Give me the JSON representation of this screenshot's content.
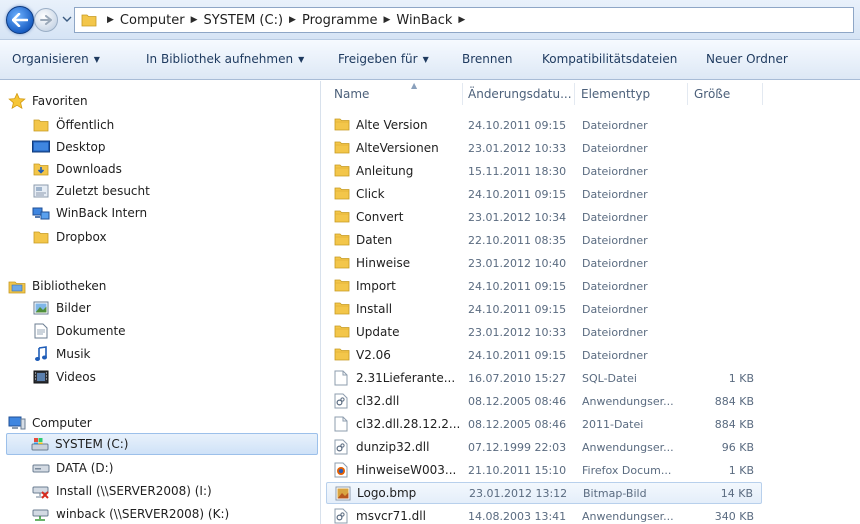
{
  "address": {
    "crumbs": [
      "Computer",
      "SYSTEM (C:)",
      "Programme",
      "WinBack"
    ]
  },
  "toolbar": {
    "organize": "Organisieren",
    "library": "In Bibliothek aufnehmen",
    "share": "Freigeben für",
    "burn": "Brennen",
    "compat": "Kompatibilitätsdateien",
    "new_folder": "Neuer Ordner"
  },
  "nav": {
    "favorites": {
      "label": "Favoriten",
      "items": [
        "Öffentlich",
        "Desktop",
        "Downloads",
        "Zuletzt besucht",
        "WinBack Intern",
        "Dropbox"
      ]
    },
    "libraries": {
      "label": "Bibliotheken",
      "items": [
        "Bilder",
        "Dokumente",
        "Musik",
        "Videos"
      ]
    },
    "computer": {
      "label": "Computer",
      "items": [
        "SYSTEM (C:)",
        "DATA (D:)",
        "Install (\\\\SERVER2008) (I:)",
        "winback (\\\\SERVER2008) (K:)"
      ]
    }
  },
  "columns": {
    "name": "Name",
    "date": "Änderungsdatu...",
    "type": "Elementtyp",
    "size": "Größe"
  },
  "files": [
    {
      "name": "Alte Version",
      "date": "24.10.2011 09:15",
      "type": "Dateiordner",
      "size": "",
      "icon": "folder-icon"
    },
    {
      "name": "AlteVersionen",
      "date": "23.01.2012 10:33",
      "type": "Dateiordner",
      "size": "",
      "icon": "folder-icon"
    },
    {
      "name": "Anleitung",
      "date": "15.11.2011 18:30",
      "type": "Dateiordner",
      "size": "",
      "icon": "folder-icon"
    },
    {
      "name": "Click",
      "date": "24.10.2011 09:15",
      "type": "Dateiordner",
      "size": "",
      "icon": "folder-icon"
    },
    {
      "name": "Convert",
      "date": "23.01.2012 10:34",
      "type": "Dateiordner",
      "size": "",
      "icon": "folder-icon"
    },
    {
      "name": "Daten",
      "date": "22.10.2011 08:35",
      "type": "Dateiordner",
      "size": "",
      "icon": "folder-icon"
    },
    {
      "name": "Hinweise",
      "date": "23.01.2012 10:40",
      "type": "Dateiordner",
      "size": "",
      "icon": "folder-icon"
    },
    {
      "name": "Import",
      "date": "24.10.2011 09:15",
      "type": "Dateiordner",
      "size": "",
      "icon": "folder-icon"
    },
    {
      "name": "Install",
      "date": "24.10.2011 09:15",
      "type": "Dateiordner",
      "size": "",
      "icon": "folder-icon"
    },
    {
      "name": "Update",
      "date": "23.01.2012 10:33",
      "type": "Dateiordner",
      "size": "",
      "icon": "folder-icon"
    },
    {
      "name": "V2.06",
      "date": "24.10.2011 09:15",
      "type": "Dateiordner",
      "size": "",
      "icon": "folder-icon"
    },
    {
      "name": "2.31Lieferante...",
      "date": "16.07.2010 15:27",
      "type": "SQL-Datei",
      "size": "1 KB",
      "icon": "file-icon"
    },
    {
      "name": "cl32.dll",
      "date": "08.12.2005 08:46",
      "type": "Anwendungser...",
      "size": "884 KB",
      "icon": "dll-icon"
    },
    {
      "name": "cl32.dll.28.12.2...",
      "date": "08.12.2005 08:46",
      "type": "2011-Datei",
      "size": "884 KB",
      "icon": "file-icon"
    },
    {
      "name": "dunzip32.dll",
      "date": "07.12.1999 22:03",
      "type": "Anwendungser...",
      "size": "96 KB",
      "icon": "dll-icon"
    },
    {
      "name": "HinweiseW003...",
      "date": "21.10.2011 15:10",
      "type": "Firefox Docum...",
      "size": "1 KB",
      "icon": "firefox-icon"
    },
    {
      "name": "Logo.bmp",
      "date": "23.01.2012 13:12",
      "type": "Bitmap-Bild",
      "size": "14 KB",
      "icon": "bitmap-icon"
    },
    {
      "name": "msvcr71.dll",
      "date": "14.08.2003 13:41",
      "type": "Anwendungser...",
      "size": "340 KB",
      "icon": "dll-icon"
    }
  ]
}
